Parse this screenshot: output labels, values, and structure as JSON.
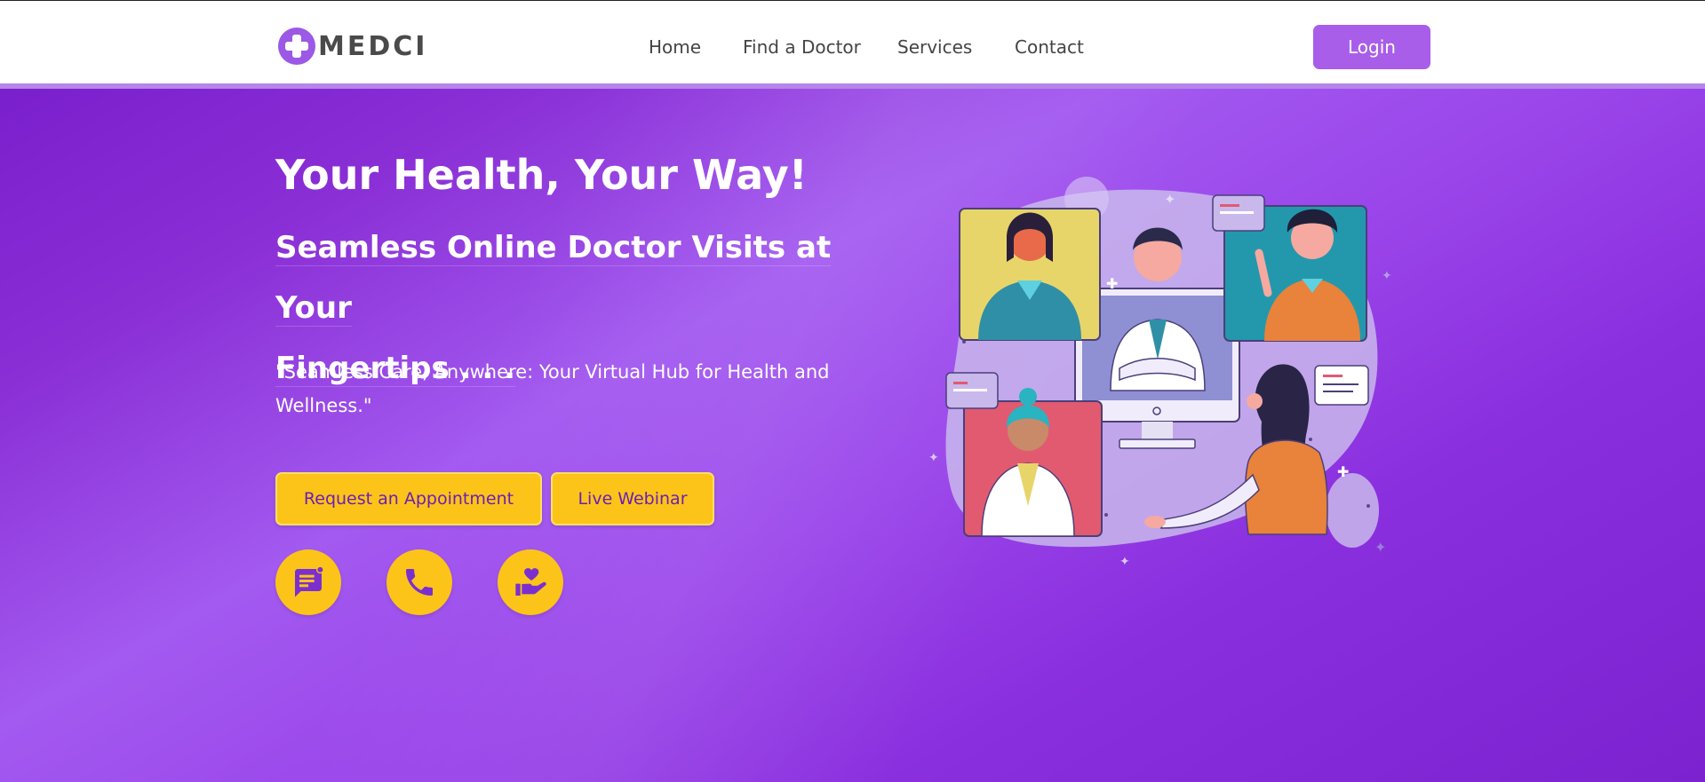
{
  "brand": {
    "name": "MEDCI",
    "logo_icon": "medical-cross-icon",
    "accent": "#9b59e6"
  },
  "nav": {
    "links": [
      {
        "label": "Home"
      },
      {
        "label": "Find a Doctor"
      },
      {
        "label": "Services"
      },
      {
        "label": "Contact"
      }
    ],
    "login_label": "Login"
  },
  "hero": {
    "headline": "Your Health, Your Way!",
    "subhead_line1": "Seamless Online Doctor Visits at Your",
    "subhead_line2": "Fingertips . . .",
    "tagline": "\"Seamless Care, Anywhere: Your Virtual Hub for Health and Wellness.\"",
    "buttons": {
      "appointment": "Request an Appointment",
      "webinar": "Live Webinar"
    },
    "quick_actions": [
      {
        "icon": "chat-icon"
      },
      {
        "icon": "phone-icon"
      },
      {
        "icon": "hand-heart-icon"
      }
    ],
    "illustration": "telemedicine-video-call-illustration"
  },
  "colors": {
    "primary_purple": "#8a2be2",
    "button_yellow": "#fcc419",
    "login_purple": "#a85ee8"
  }
}
